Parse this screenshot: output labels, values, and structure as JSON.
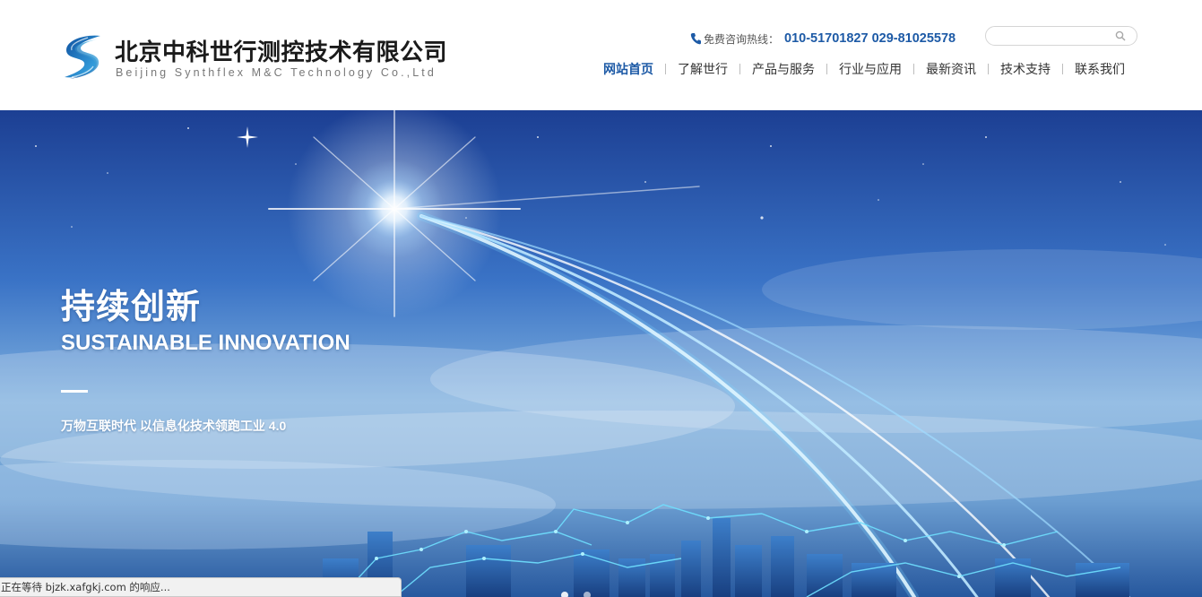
{
  "header": {
    "company_name_cn": "北京中科世行测控技术有限公司",
    "company_name_en": "Beijing Synthflex M&C Technology Co.,Ltd",
    "hotline_label": "免费咨询热线：",
    "hotline_numbers": "010-51701827 029-81025578",
    "logo_icon": "s-swirl-logo",
    "phone_icon": "phone-icon"
  },
  "search": {
    "value": "",
    "placeholder": "",
    "icon": "search-icon"
  },
  "nav": {
    "items": [
      {
        "label": "网站首页",
        "active": true
      },
      {
        "label": "了解世行",
        "active": false
      },
      {
        "label": "产品与服务",
        "active": false
      },
      {
        "label": "行业与应用",
        "active": false
      },
      {
        "label": "最新资讯",
        "active": false
      },
      {
        "label": "技术支持",
        "active": false
      },
      {
        "label": "联系我们",
        "active": false
      }
    ]
  },
  "banner": {
    "title_cn": "持续创新",
    "title_en": "SUSTAINABLE INNOVATION",
    "subtitle": "万物互联时代  以信息化技术领跑工业 4.0"
  },
  "status_bar": {
    "text": "正在等待 bjzk.xafgkj.com 的响应..."
  },
  "colors": {
    "brand_blue": "#1d5aa6",
    "nav_text": "#333333",
    "banner_sky": "#2a5fb8"
  }
}
